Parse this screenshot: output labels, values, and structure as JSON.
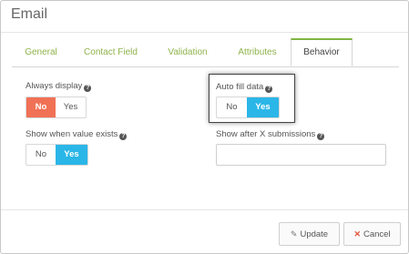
{
  "dialog": {
    "title": "Email"
  },
  "tabs": [
    {
      "label": "General"
    },
    {
      "label": "Contact Field"
    },
    {
      "label": "Validation"
    },
    {
      "label": "Attributes"
    },
    {
      "label": "Behavior",
      "active": true
    }
  ],
  "fields": {
    "always_display": {
      "label": "Always display",
      "no": "No",
      "yes": "Yes",
      "value": "No"
    },
    "auto_fill": {
      "label": "Auto fill data",
      "no": "No",
      "yes": "Yes",
      "value": "Yes"
    },
    "show_when_exists": {
      "label": "Show when value exists",
      "no": "No",
      "yes": "Yes",
      "value": "Yes"
    },
    "show_after_x": {
      "label": "Show after X submissions",
      "value": ""
    }
  },
  "footer": {
    "update_label": "Update",
    "cancel_label": "Cancel"
  },
  "icons": {
    "help": "help-circle-icon",
    "update": "pencil-icon",
    "cancel": "close-icon"
  },
  "colors": {
    "tab_active_border": "#7fb543",
    "tab_text": "#8fb34b",
    "no_on": "#f07155",
    "yes_on": "#2bb6e8",
    "cancel_icon": "#e2533a"
  }
}
